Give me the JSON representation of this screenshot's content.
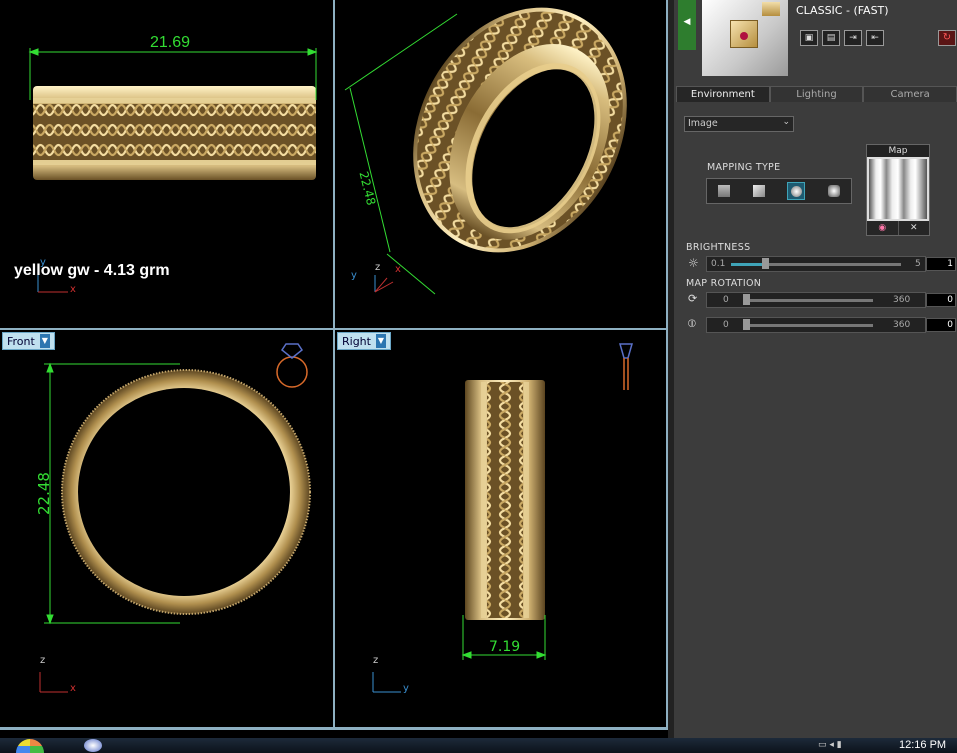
{
  "viewports": {
    "top_left": {
      "dimension": "21.69",
      "weight_label": "yellow gw - 4.13 grm",
      "axes": [
        "y",
        "x"
      ]
    },
    "top_right": {
      "dimension": "22.48",
      "axes": [
        "y",
        "z",
        "x"
      ]
    },
    "front": {
      "label": "Front",
      "dimension": "22.48",
      "axes": [
        "z",
        "x"
      ]
    },
    "right": {
      "label": "Right",
      "dimension": "7.19",
      "axes": [
        "z",
        "y"
      ]
    }
  },
  "panel": {
    "render_mode": "CLASSIC - (FAST)",
    "tabs": [
      "Environment",
      "Lighting",
      "Camera"
    ],
    "active_tab": "Environment",
    "env_select": "Image",
    "mapping_type_label": "MAPPING TYPE",
    "map_label": "Map",
    "brightness": {
      "label": "BRIGHTNESS",
      "min": "0.1",
      "max": "5",
      "value": "1",
      "level": 0.18
    },
    "map_rotation": {
      "label": "MAP ROTATION",
      "rows": [
        {
          "min": "0",
          "max": "360",
          "value": "0"
        },
        {
          "min": "0",
          "max": "360",
          "value": "0"
        }
      ]
    }
  },
  "taskbar": {
    "time": "12:16 PM"
  },
  "colors": {
    "accent": "#3fa4b8",
    "dimension": "#33dd33",
    "panel_bg": "#3c3c3c",
    "gold": "#d8bd7e"
  }
}
